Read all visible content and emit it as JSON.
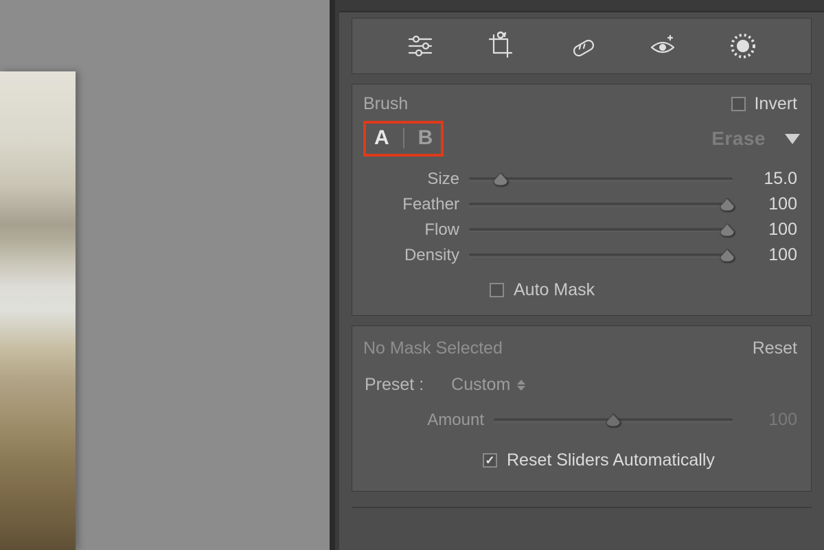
{
  "toolbar": {
    "icons": [
      "sliders-icon",
      "crop-icon",
      "healing-icon",
      "redeye-icon",
      "radial-mask-icon"
    ]
  },
  "brush": {
    "title": "Brush",
    "invert_label": "Invert",
    "invert_checked": false,
    "a_label": "A",
    "b_label": "B",
    "erase_label": "Erase",
    "sliders": {
      "size": {
        "label": "Size",
        "value": "15.0",
        "pos": 12
      },
      "feather": {
        "label": "Feather",
        "value": "100",
        "pos": 98
      },
      "flow": {
        "label": "Flow",
        "value": "100",
        "pos": 98
      },
      "density": {
        "label": "Density",
        "value": "100",
        "pos": 98
      }
    },
    "automask_label": "Auto Mask",
    "automask_checked": false
  },
  "mask": {
    "status": "No Mask Selected",
    "reset_label": "Reset",
    "preset_label": "Preset :",
    "preset_value": "Custom",
    "amount": {
      "label": "Amount",
      "value": "100",
      "pos": 50
    },
    "reset_sliders_label": "Reset Sliders Automatically",
    "reset_sliders_checked": true
  }
}
